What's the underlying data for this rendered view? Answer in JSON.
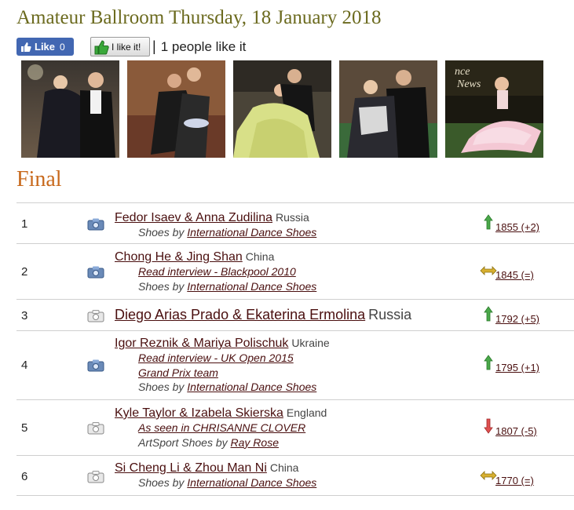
{
  "page": {
    "title": "Amateur Ballroom Thursday, 18 January 2018"
  },
  "likebar": {
    "fb_label": "Like",
    "fb_count": "0",
    "ilike_label": "I like it!",
    "separator": "|",
    "likes_text": "1 people like it"
  },
  "photos": [
    {
      "name": "photo-1",
      "icon": "dance-photo"
    },
    {
      "name": "photo-2",
      "icon": "dance-photo"
    },
    {
      "name": "photo-3",
      "icon": "dance-photo"
    },
    {
      "name": "photo-4",
      "icon": "dance-photo"
    },
    {
      "name": "photo-5",
      "icon": "dance-photo"
    }
  ],
  "final": {
    "heading": "Final"
  },
  "results": [
    {
      "rank": "1",
      "couple": "Fedor Isaev & Anna Zudilina",
      "country": "Russia",
      "lines": [
        {
          "prefix": "Shoes by ",
          "link": "International Dance Shoes"
        }
      ],
      "trend": "up",
      "rating": "1855 (+2)",
      "photo_icon": "camera-blue"
    },
    {
      "rank": "2",
      "couple": "Chong He & Jing Shan",
      "country": "China",
      "lines": [
        {
          "prefix": "",
          "link": "Read interview - Blackpool 2010"
        },
        {
          "prefix": "Shoes by ",
          "link": "International Dance Shoes"
        }
      ],
      "trend": "same",
      "rating": "1845 (=)",
      "photo_icon": "camera-blue"
    },
    {
      "rank": "3",
      "couple": "Diego Arias Prado & Ekaterina Ermolina",
      "country": "Russia",
      "lines": [],
      "trend": "up",
      "rating": "1792 (+5)",
      "photo_icon": "camera-grey"
    },
    {
      "rank": "4",
      "couple": "Igor Reznik & Mariya Polischuk",
      "country": "Ukraine",
      "lines": [
        {
          "prefix": "",
          "link": "Read interview - UK Open 2015"
        },
        {
          "prefix": "",
          "link": "Grand Prix team"
        },
        {
          "prefix": "Shoes by ",
          "link": "International Dance Shoes"
        }
      ],
      "trend": "up",
      "rating": "1795 (+1)",
      "photo_icon": "camera-blue"
    },
    {
      "rank": "5",
      "couple": "Kyle Taylor & Izabela Skierska",
      "country": "England",
      "lines": [
        {
          "prefix": "",
          "link": "As seen in CHRISANNE CLOVER"
        },
        {
          "prefix": "ArtSport Shoes by ",
          "link": "Ray Rose"
        }
      ],
      "trend": "down",
      "rating": "1807 (-5)",
      "photo_icon": "camera-grey"
    },
    {
      "rank": "6",
      "couple": "Si Cheng Li & Zhou Man Ni",
      "country": "China",
      "lines": [
        {
          "prefix": "Shoes by ",
          "link": "International Dance Shoes"
        }
      ],
      "trend": "same",
      "rating": "1770 (=)",
      "photo_icon": "camera-grey"
    }
  ],
  "colors": {
    "title": "#6b6a1e",
    "final": "#c8691c",
    "link": "#4a0f0f",
    "fb_blue": "#4267b2",
    "up": "#3a9a3a",
    "down": "#d43a3a",
    "same": "#c9a21e"
  }
}
